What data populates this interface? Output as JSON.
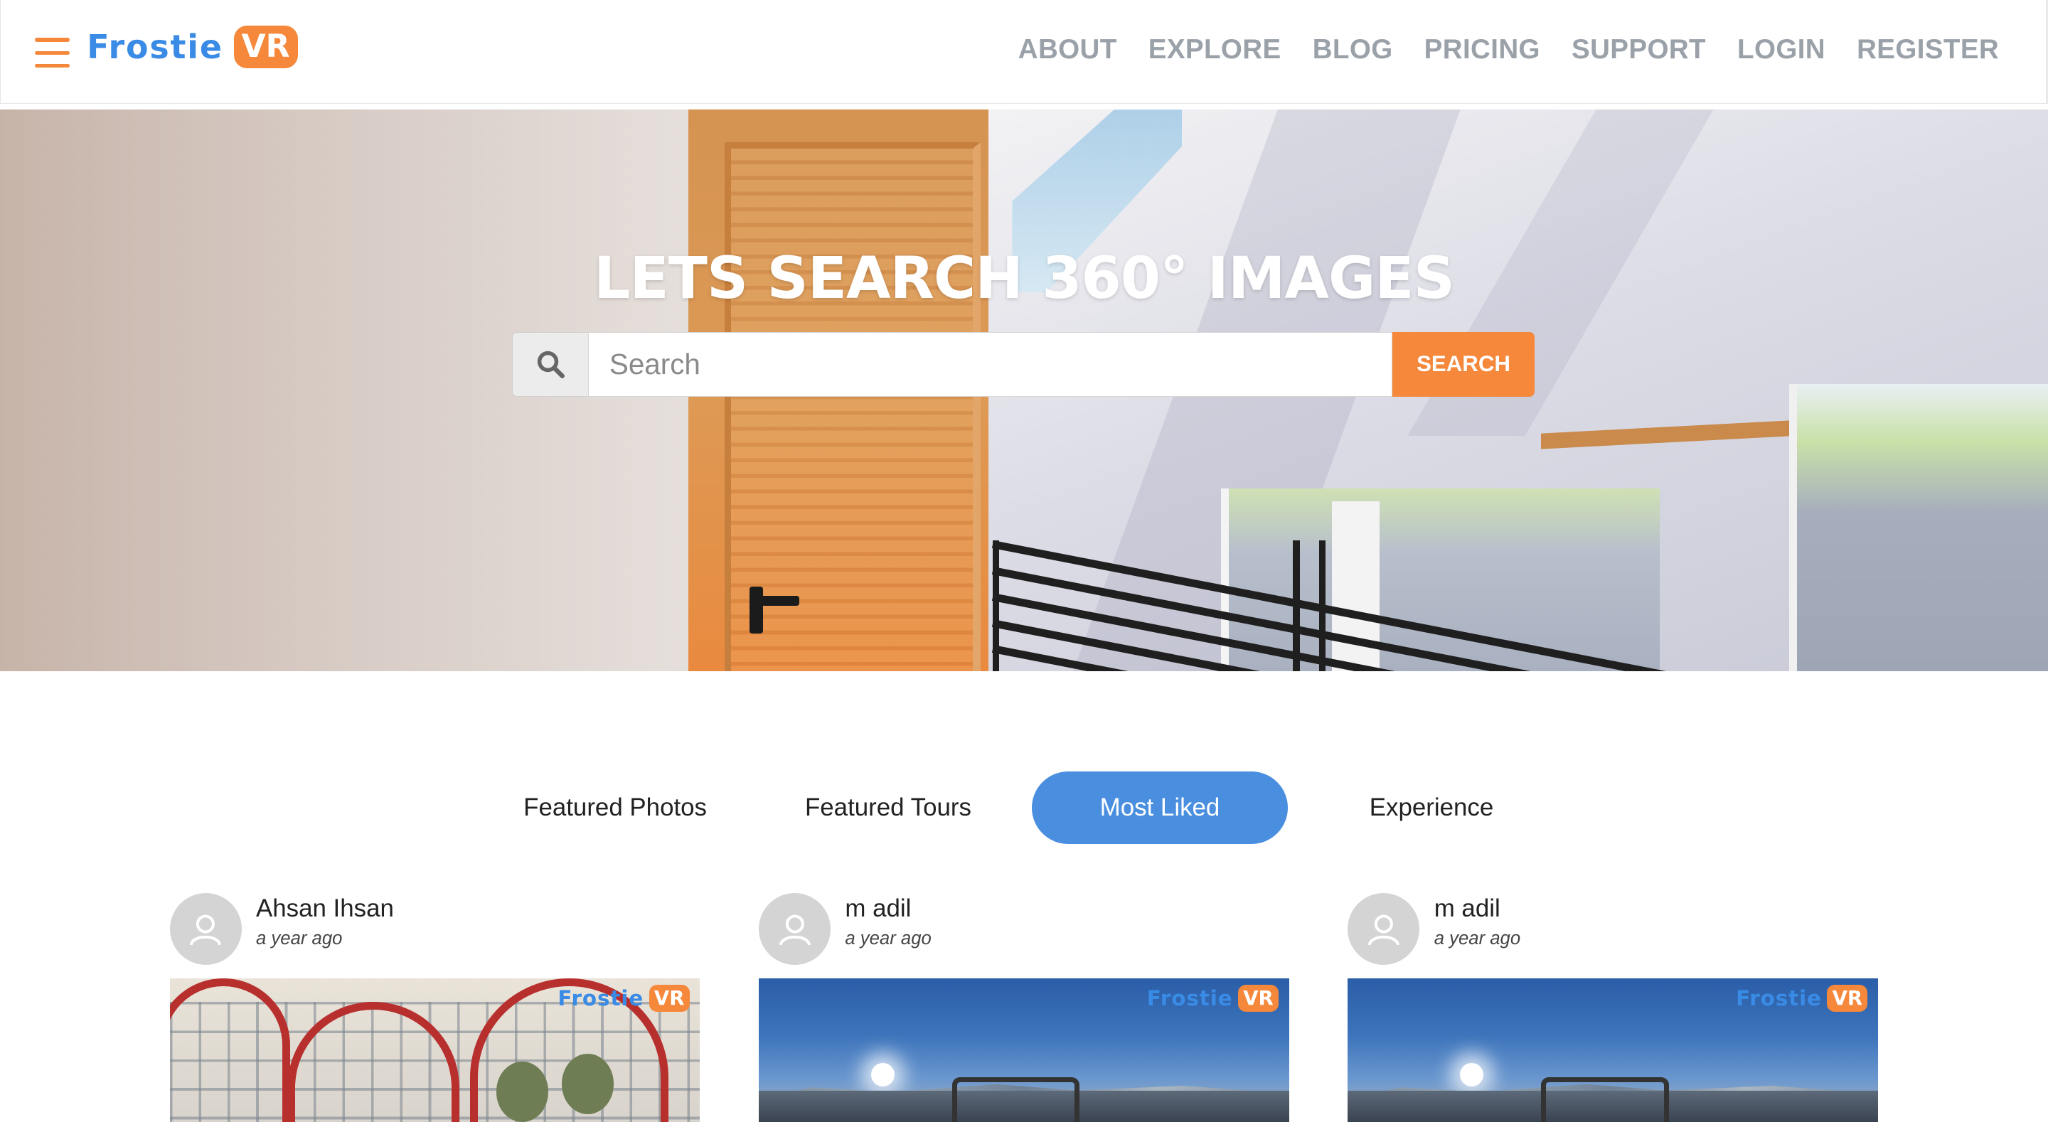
{
  "header": {
    "logo": {
      "text": "Frostie",
      "badge": "VR"
    },
    "menu_icon": "hamburger-icon",
    "nav": [
      "ABOUT",
      "EXPLORE",
      "BLOG",
      "PRICING",
      "SUPPORT",
      "LOGIN",
      "REGISTER"
    ]
  },
  "hero": {
    "title": "LETS SEARCH 360° IMAGES",
    "search": {
      "icon": "search-icon",
      "placeholder": "Search",
      "value": "",
      "button": "SEARCH"
    }
  },
  "tabs": [
    {
      "label": "Featured Photos",
      "active": false
    },
    {
      "label": "Featured Tours",
      "active": false
    },
    {
      "label": "Most Liked",
      "active": true
    },
    {
      "label": "Experience",
      "active": false
    }
  ],
  "cards": [
    {
      "author": "Ahsan Ihsan",
      "time": "a year ago",
      "watermark": {
        "text": "Frostie",
        "badge": "VR"
      }
    },
    {
      "author": "m adil",
      "time": "a year ago",
      "watermark": {
        "text": "Frostie",
        "badge": "VR"
      }
    },
    {
      "author": "m adil",
      "time": "a year ago",
      "watermark": {
        "text": "Frostie",
        "badge": "VR"
      }
    }
  ],
  "colors": {
    "accent": "#f5883a",
    "brand_blue": "#3a8be6",
    "tab_active": "#4a8fdf",
    "nav_text": "#9aa1a9"
  }
}
